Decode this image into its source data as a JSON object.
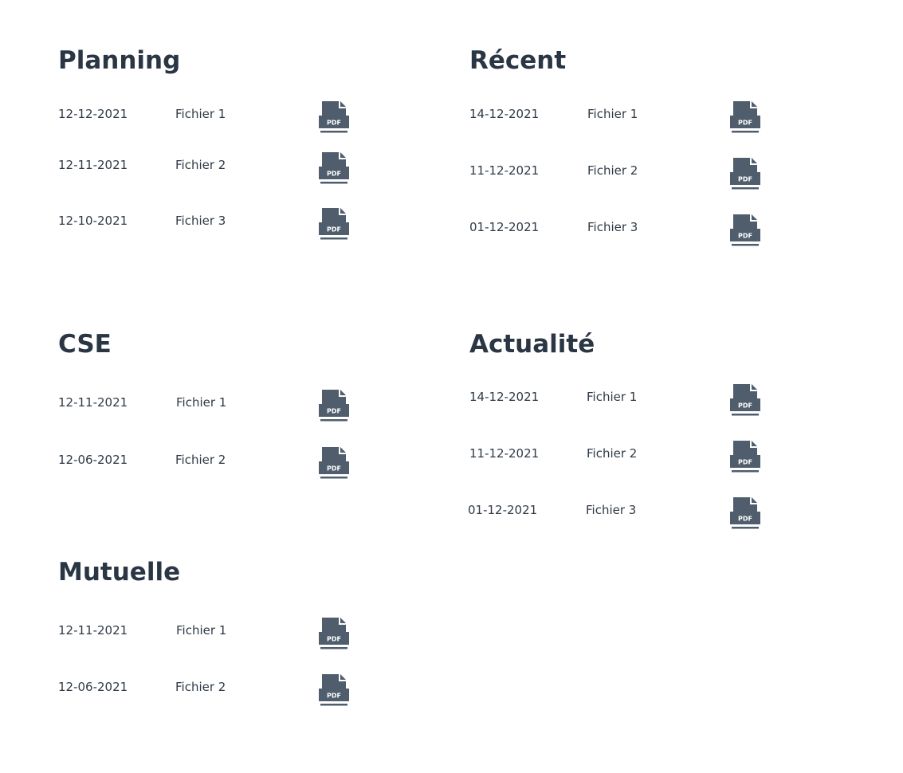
{
  "colors": {
    "title": "#2a3644",
    "text": "#2f3a46",
    "icon": "#4f5d6d",
    "icon_text": "#ffffff"
  },
  "icon": {
    "name": "pdf-file-icon",
    "label": "PDF"
  },
  "sections": {
    "planning": {
      "title": "Planning",
      "rows": [
        {
          "date": "12-12-2021",
          "name": "Fichier 1"
        },
        {
          "date": "12-11-2021",
          "name": "Fichier 2"
        },
        {
          "date": "12-10-2021",
          "name": "Fichier 3"
        }
      ]
    },
    "recent": {
      "title": "Récent",
      "rows": [
        {
          "date": "14-12-2021",
          "name": "Fichier 1"
        },
        {
          "date": "11-12-2021",
          "name": "Fichier 2"
        },
        {
          "date": "01-12-2021",
          "name": "Fichier 3"
        }
      ]
    },
    "cse": {
      "title": "CSE",
      "rows": [
        {
          "date": "12-11-2021",
          "name": "Fichier 1"
        },
        {
          "date": "12-06-2021",
          "name": "Fichier 2"
        }
      ]
    },
    "actualite": {
      "title": "Actualité",
      "rows": [
        {
          "date": "14-12-2021",
          "name": "Fichier 1"
        },
        {
          "date": "11-12-2021",
          "name": "Fichier 2"
        },
        {
          "date": "01-12-2021",
          "name": "Fichier 3"
        }
      ]
    },
    "mutuelle": {
      "title": "Mutuelle",
      "rows": [
        {
          "date": "12-11-2021",
          "name": "Fichier 1"
        },
        {
          "date": "12-06-2021",
          "name": "Fichier 2"
        }
      ]
    }
  }
}
